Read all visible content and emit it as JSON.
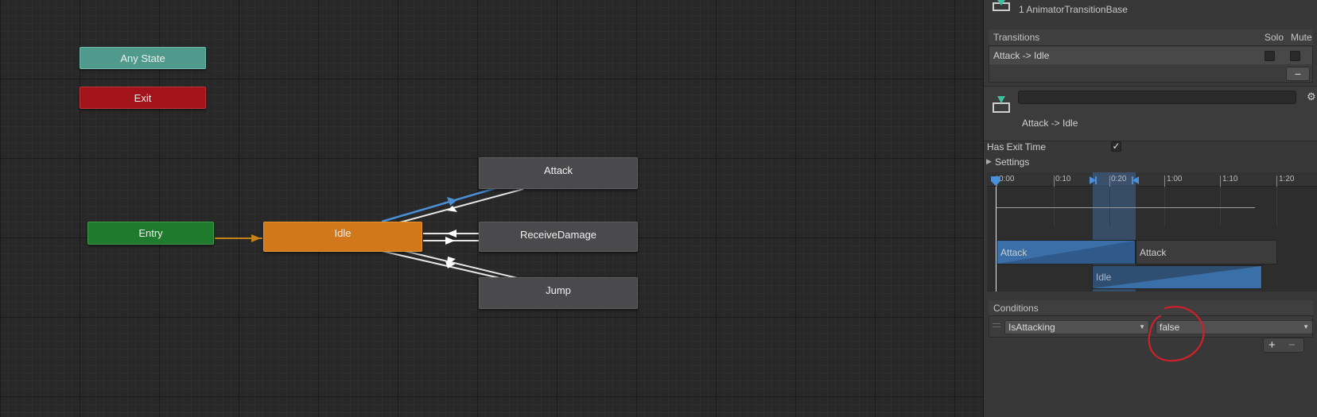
{
  "colors": {
    "entry": "#1f7a2d",
    "exit": "#a3141a",
    "any_state": "#4f9a8c",
    "idle": "#d2781c",
    "state": "#4a4a4c",
    "selected_transition": "#4a90d9",
    "entry_transition": "#c48318",
    "clip": "#3a6fa8",
    "annotation": "#d0202a"
  },
  "graph": {
    "nodes": {
      "any_state": "Any State",
      "exit": "Exit",
      "entry": "Entry",
      "idle": "Idle",
      "attack": "Attack",
      "receive_damage": "ReceiveDamage",
      "jump": "Jump"
    }
  },
  "inspector": {
    "header_title": "1 AnimatorTransitionBase",
    "transitions": {
      "label": "Transitions",
      "solo_label": "Solo",
      "mute_label": "Mute",
      "items": [
        {
          "label": "Attack -> Idle",
          "solo": false,
          "mute": false
        }
      ],
      "remove_label": "−"
    },
    "selected": {
      "name_value": "",
      "title": "Attack -> Idle"
    },
    "has_exit_time": {
      "label": "Has Exit Time",
      "checked": true,
      "mark": "✓"
    },
    "settings_label": "Settings",
    "timeline": {
      "ticks": [
        "0:00",
        "0:10",
        "0:20",
        "1:00",
        "1:10",
        "1:20"
      ],
      "clips": {
        "source_a": "Attack",
        "source_b": "Attack",
        "target": "Idle"
      }
    },
    "conditions": {
      "label": "Conditions",
      "parameter": "IsAttacking",
      "value": "false",
      "add_label": "+",
      "remove_label": "−"
    }
  }
}
